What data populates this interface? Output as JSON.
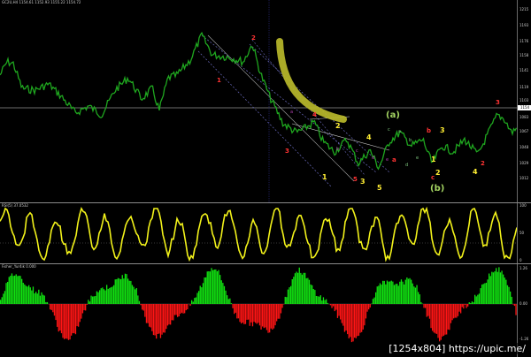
{
  "main_pane": {
    "title": "GC2U,H4 1154.61 1152.93 1155.22 1154.72",
    "price_scale": [
      "1215",
      "1193",
      "1176",
      "1158",
      "1141",
      "1119",
      "1103",
      "1083",
      "1067",
      "1048",
      "1029",
      "1012"
    ],
    "current_price": "1154",
    "wave_labels": [
      {
        "text": "1",
        "color": "#ff3333"
      },
      {
        "text": "2",
        "color": "#ff3333"
      },
      {
        "text": "3",
        "color": "#ff3333"
      },
      {
        "text": "4",
        "color": "#ff3333"
      },
      {
        "text": "5",
        "color": "#ff3333"
      },
      {
        "text": "2",
        "color": "#ffee33"
      },
      {
        "text": "4",
        "color": "#ffee33"
      },
      {
        "text": "1",
        "color": "#ffee33"
      },
      {
        "text": "3",
        "color": "#ffee33"
      },
      {
        "text": "5",
        "color": "#ffee33"
      },
      {
        "text": "(a)",
        "color": "#a4d462"
      },
      {
        "text": "(b)",
        "color": "#a4d462"
      },
      {
        "text": "a",
        "color": "#ff3333"
      },
      {
        "text": "b",
        "color": "#ff3333"
      },
      {
        "text": "c",
        "color": "#ff3333"
      },
      {
        "text": "1",
        "color": "#ffee33"
      },
      {
        "text": "2",
        "color": "#ffee33"
      },
      {
        "text": "3",
        "color": "#ffee33"
      },
      {
        "text": "4",
        "color": "#ffee33"
      },
      {
        "text": "2",
        "color": "#ff3333"
      },
      {
        "text": "3",
        "color": "#ff3333"
      }
    ],
    "minor_labels": [
      "a",
      "b",
      "c",
      "d",
      "e",
      "a",
      "b",
      "c",
      "d",
      "e"
    ]
  },
  "rsi_pane": {
    "title": "RSI(5) 37.0532",
    "scale": [
      "100",
      "50",
      "0"
    ]
  },
  "fisher_pane": {
    "title": "Fisher_Yur4ik 0.000",
    "scale": [
      "1.26",
      "0.00",
      "-1.26"
    ]
  },
  "watermark": "[1254x804] https://upic.me/",
  "colors": {
    "price_line": "#1fa71f",
    "rsi_line": "#f2f21a",
    "fisher_pos": "#11e411",
    "fisher_neg": "#ff1515",
    "highlight": "#b8b82a"
  }
}
